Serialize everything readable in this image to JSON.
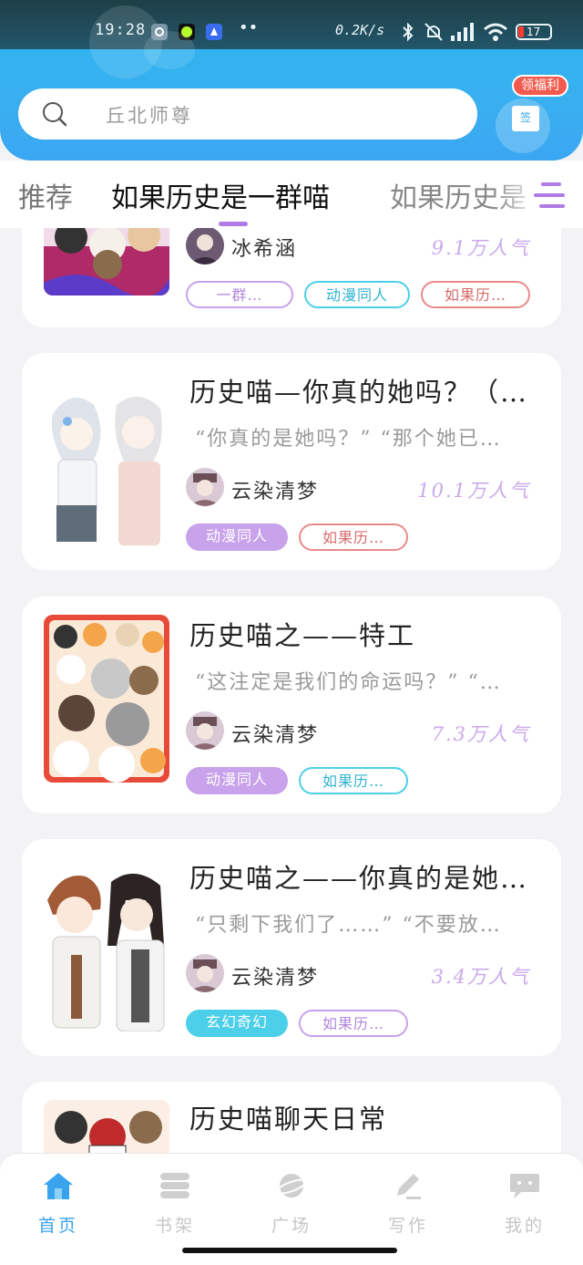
{
  "status_bar": {
    "time": "19:28",
    "net_speed": "0.2K/s",
    "dots": "••",
    "battery": "17",
    "battery_color": "#ff3b30",
    "icons": [
      "gear-icon",
      "app-icon-green",
      "app-icon-rocket",
      "bluetooth-icon",
      "mute-bell-icon",
      "signal-icon",
      "wifi-icon",
      "battery-icon"
    ]
  },
  "search": {
    "placeholder": "丘北师尊"
  },
  "gift": {
    "badge": "领福利",
    "box_label": "签"
  },
  "tabs": [
    {
      "label": "推荐"
    },
    {
      "label": "如果历史是一群喵"
    },
    {
      "label": "如果历史是"
    }
  ],
  "cards": [
    {
      "author": "冰希涵",
      "popularity": "9.1万人气",
      "tags": [
        "一群…",
        "动漫同人",
        "如果历…"
      ]
    },
    {
      "title": "历史喵—你真的她吗？（…",
      "quote": "“你真的是她吗？” “那个她已…",
      "author": "云染清梦",
      "popularity": "10.1万人气",
      "tags": [
        "动漫同人",
        "如果历…"
      ]
    },
    {
      "title": "历史喵之——特工",
      "quote": "“这注定是我们的命运吗？” “…",
      "author": "云染清梦",
      "popularity": "7.3万人气",
      "tags": [
        "动漫同人",
        "如果历…"
      ]
    },
    {
      "title": "历史喵之——你真的是她…",
      "quote": "“只剩下我们了……” “不要放…",
      "author": "云染清梦",
      "popularity": "3.4万人气",
      "tags": [
        "玄幻奇幻",
        "如果历…"
      ]
    },
    {
      "title": "历史喵聊天日常"
    }
  ],
  "bottom_nav": [
    {
      "label": "首页",
      "icon": "home-icon",
      "active": true
    },
    {
      "label": "书架",
      "icon": "bookshelf-icon",
      "active": false
    },
    {
      "label": "广场",
      "icon": "planet-icon",
      "active": false
    },
    {
      "label": "写作",
      "icon": "pen-icon",
      "active": false
    },
    {
      "label": "我的",
      "icon": "chat-bubble-icon",
      "active": false
    }
  ],
  "colors": {
    "accent_blue": "#3aa3ee",
    "accent_purple": "#b07be6",
    "tag_purple": "#c8a2ea",
    "tag_cyan": "#4ccfe8",
    "tag_red": "#ea8a8a"
  }
}
